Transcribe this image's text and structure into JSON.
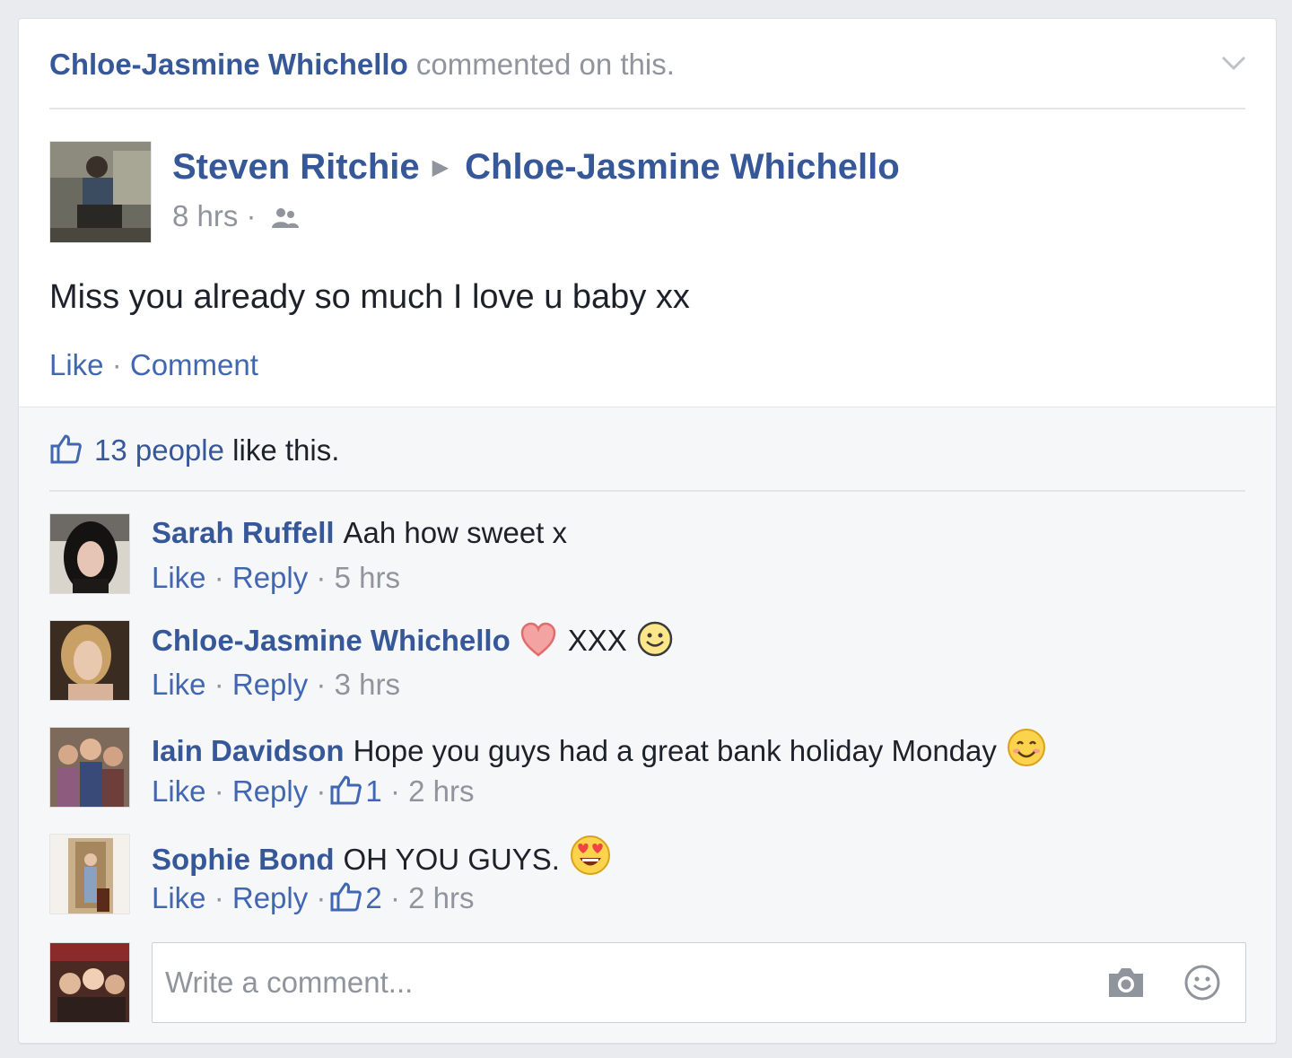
{
  "story": {
    "actor": "Chloe-Jasmine Whichello",
    "action": " commented on this."
  },
  "post": {
    "author": "Steven Ritchie",
    "target": "Chloe-Jasmine Whichello",
    "time": "8 hrs",
    "separator": " · ",
    "audience_icon": "friends-audience-icon",
    "text": "Miss you already so much I love u baby xx",
    "like_label": "Like",
    "comment_label": "Comment"
  },
  "likes": {
    "count_text": "13 people",
    "suffix": " like this."
  },
  "comments": [
    {
      "author": "Sarah Ruffell",
      "text": "Aah how sweet x",
      "like": "Like",
      "reply": "Reply",
      "time": "5 hrs"
    },
    {
      "author": "Chloe-Jasmine Whichello",
      "text": "XXX",
      "like": "Like",
      "reply": "Reply",
      "time": "3 hrs",
      "emojis": [
        "heart-icon",
        "smile-icon"
      ]
    },
    {
      "author": "Iain Davidson",
      "text": "Hope you guys had a great bank holiday Monday",
      "like": "Like",
      "reply": "Reply",
      "likes": "1",
      "time": "2 hrs",
      "emojis": [
        "blush-smile-icon"
      ]
    },
    {
      "author": "Sophie Bond",
      "text": "OH YOU GUYS.",
      "like": "Like",
      "reply": "Reply",
      "likes": "2",
      "time": "2 hrs",
      "emojis": [
        "heart-eyes-icon"
      ]
    }
  ],
  "composer": {
    "placeholder": "Write a comment...",
    "icons": [
      "camera-icon",
      "emoji-icon"
    ]
  },
  "colors": {
    "link": "#365899",
    "action_link": "#4267b2",
    "meta": "#90949c",
    "text": "#1d2129",
    "ufi_bg": "#f6f7f9",
    "page_bg": "#e9ebee"
  }
}
